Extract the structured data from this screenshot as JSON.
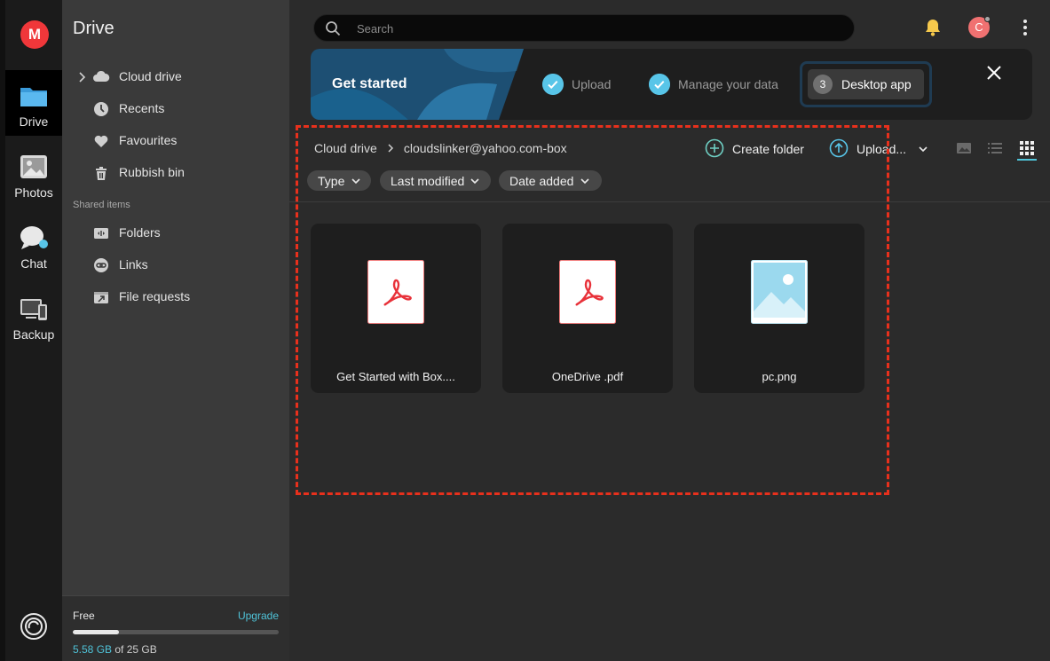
{
  "app": {
    "logo_letter": "M"
  },
  "rail": {
    "items": [
      {
        "label": "Drive",
        "icon": "folder-icon"
      },
      {
        "label": "Photos",
        "icon": "photos-icon"
      },
      {
        "label": "Chat",
        "icon": "chat-icon"
      },
      {
        "label": "Backup",
        "icon": "backup-icon"
      }
    ]
  },
  "sidebar": {
    "title": "Drive",
    "items": [
      {
        "label": "Cloud drive",
        "icon": "cloud-icon"
      },
      {
        "label": "Recents",
        "icon": "clock-icon"
      },
      {
        "label": "Favourites",
        "icon": "heart-icon"
      },
      {
        "label": "Rubbish bin",
        "icon": "trash-icon"
      }
    ],
    "shared_section": "Shared items",
    "shared_items": [
      {
        "label": "Folders",
        "icon": "shared-folder-icon"
      },
      {
        "label": "Links",
        "icon": "link-icon"
      },
      {
        "label": "File requests",
        "icon": "file-request-icon"
      }
    ],
    "storage": {
      "plan": "Free",
      "upgrade_label": "Upgrade",
      "used": "5.58 GB",
      "total_text": " of 25 GB",
      "used_fraction": 0.2232
    }
  },
  "topbar": {
    "search_placeholder": "Search",
    "avatar_letter": "C"
  },
  "banner": {
    "title": "Get started",
    "steps": [
      {
        "label": "Upload",
        "done": true
      },
      {
        "label": "Manage your data",
        "done": true
      },
      {
        "label": "Desktop app",
        "number": "3",
        "done": false
      }
    ]
  },
  "breadcrumb": {
    "root": "Cloud drive",
    "current": "cloudslinker@yahoo.com-box"
  },
  "toolbar": {
    "create_folder": "Create folder",
    "upload": "Upload..."
  },
  "filters": [
    {
      "label": "Type"
    },
    {
      "label": "Last modified"
    },
    {
      "label": "Date added"
    }
  ],
  "files": [
    {
      "name": "Get Started with Box....",
      "type": "pdf"
    },
    {
      "name": "OneDrive .pdf",
      "type": "pdf"
    },
    {
      "name": "pc.png",
      "type": "image"
    }
  ],
  "colors": {
    "accent": "#4fc3d8",
    "brand": "#f0373a",
    "selection": "#e8301c"
  }
}
